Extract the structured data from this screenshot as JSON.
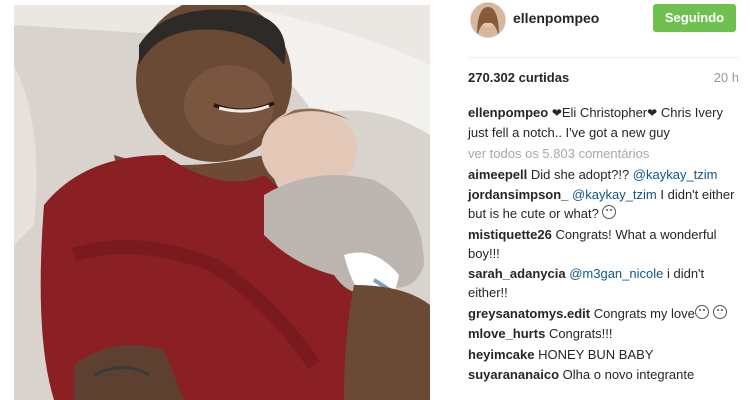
{
  "post": {
    "username": "ellenpompeo",
    "follow_button": "Seguindo",
    "likes": "270.302 curtidas",
    "time_ago": "20 h",
    "caption_part1": "Eli Christopher",
    "caption_part2": "Chris Ivery just fell a notch.. I've got a new guy",
    "view_all_comments": "ver todos os 5.803 comentários"
  },
  "comments": [
    {
      "user": "aimeepell",
      "text": "Did she adopt?!? ",
      "mention": "@kaykay_tzim",
      "after": ""
    },
    {
      "user": "jordansimpson_",
      "text": "",
      "mention": "@kaykay_tzim",
      "after": " I didn't either but is he cute or what?"
    },
    {
      "user": "mistiquette26",
      "text": "Congrats! What a wonderful boy!!!",
      "mention": "",
      "after": ""
    },
    {
      "user": "sarah_adanycia",
      "text": "",
      "mention": "@m3gan_nicole",
      "after": " i didn't either!!"
    },
    {
      "user": "greysanatomys.edit",
      "text": "Congrats my love",
      "mention": "",
      "after": ""
    },
    {
      "user": "mlove_hurts",
      "text": "Congrats!!!",
      "mention": "",
      "after": ""
    },
    {
      "user": "heyimcake",
      "text": "HONEY BUN BABY",
      "mention": "",
      "after": ""
    },
    {
      "user": "suyarananaico",
      "text": "Olha o novo integrante",
      "mention": "",
      "after": ""
    }
  ],
  "icons": {
    "heart": "heart-icon",
    "emoji": "smiley-icon"
  },
  "colors": {
    "follow_button": "#70c050",
    "mention": "#125688",
    "muted": "#a5a7aa"
  }
}
